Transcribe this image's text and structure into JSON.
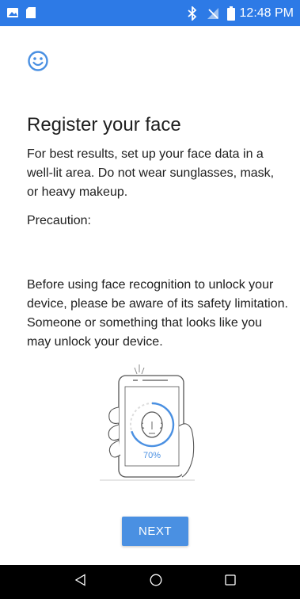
{
  "status_bar": {
    "time": "12:48 PM",
    "left_icons": [
      "image-icon",
      "sd-card-icon"
    ],
    "right_icons": [
      "bluetooth-icon",
      "no-signal-icon",
      "battery-icon"
    ]
  },
  "header": {
    "icon": "smiley-face-icon",
    "title": "Register your face"
  },
  "body": {
    "paragraph_1": "For best results, set up your face data in a well-lit area. Do not wear sunglasses, mask, or heavy makeup.",
    "precaution_label": "Precaution:",
    "paragraph_2": "Before using face recognition to unlock your device, please be aware of its safety limitation. Someone or something that looks like you may unlock your device."
  },
  "illustration": {
    "progress_label": "70%",
    "progress_value": 0.7
  },
  "actions": {
    "next_label": "NEXT"
  },
  "nav_bar": {
    "buttons": [
      "back-icon",
      "home-icon",
      "recents-icon"
    ]
  },
  "colors": {
    "status_bar": "#2d7ae6",
    "accent": "#4a90e2",
    "nav_bar": "#000000"
  }
}
